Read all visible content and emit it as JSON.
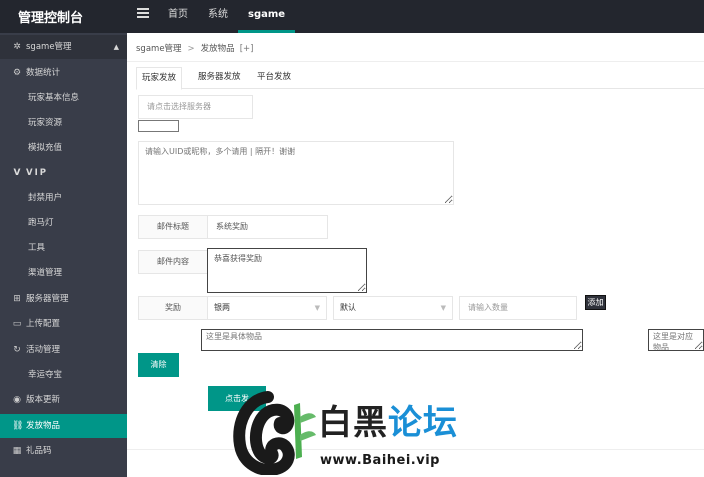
{
  "app": {
    "title": "管理控制台"
  },
  "topnav": {
    "tabs": [
      "首页",
      "系统",
      "sgame"
    ],
    "active_index": 2
  },
  "sidebar": {
    "group": "sgame管理",
    "items": [
      {
        "label": "数据统计",
        "icon": "gear-icon",
        "type": "section"
      },
      {
        "label": "玩家基本信息",
        "type": "sub"
      },
      {
        "label": "玩家资源",
        "type": "sub"
      },
      {
        "label": "模拟充值",
        "type": "sub"
      },
      {
        "label": "VIP",
        "icon": "v-icon",
        "type": "section"
      },
      {
        "label": "封禁用户",
        "type": "sub"
      },
      {
        "label": "跑马灯",
        "type": "sub"
      },
      {
        "label": "工具",
        "type": "sub"
      },
      {
        "label": "渠道管理",
        "type": "sub"
      },
      {
        "label": "服务器管理",
        "icon": "gamepad-icon",
        "type": "section"
      },
      {
        "label": "上传配置",
        "icon": "folder-icon",
        "type": "section"
      },
      {
        "label": "活动管理",
        "icon": "refresh-icon",
        "type": "section"
      },
      {
        "label": "幸运夺宝",
        "type": "sub"
      },
      {
        "label": "版本更新",
        "icon": "compass-icon",
        "type": "section"
      },
      {
        "label": "发放物品",
        "icon": "link-icon",
        "type": "section",
        "active": true
      },
      {
        "label": "礼品码",
        "icon": "grid-icon",
        "type": "section"
      }
    ]
  },
  "breadcrumb": {
    "root": "sgame管理",
    "separator": ">",
    "current": "发放物品",
    "tail": "[+]"
  },
  "tabs": [
    "玩家发放",
    "服务器发放",
    "平台发放"
  ],
  "form": {
    "server_placeholder": "请点击选择服务器",
    "uid_placeholder": "请输入UID或昵称，多个请用 | 隔开！谢谢",
    "mail_title_label": "邮件标题",
    "mail_title_value": "系统奖励",
    "mail_content_label": "邮件内容",
    "mail_content_value": "恭喜获得奖励",
    "reward_label": "奖励",
    "reward_type": "银两",
    "reward_mode": "默认",
    "quantity_placeholder": "请输入数量",
    "add_button": "添加",
    "item_placeholder": "这里是具体物品",
    "item_right_placeholder": "这里是对应物品",
    "clear_button": "清除",
    "submit_button": "点击发"
  },
  "watermark": {
    "title_part1": "白黑",
    "title_part2": "论坛",
    "url": "www.Baihei.vip"
  },
  "colors": {
    "accent": "#009688",
    "topbar": "#23262e",
    "sidebar": "#393d49",
    "watermark_blue": "#1a8fd6"
  }
}
